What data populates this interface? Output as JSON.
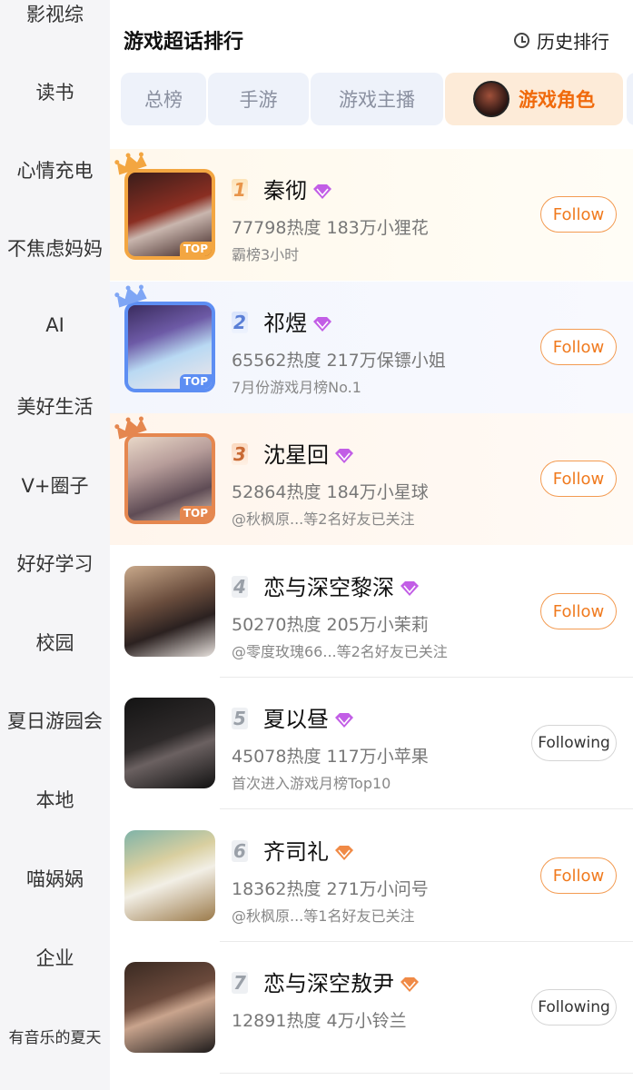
{
  "sidebar": {
    "items": [
      "影视综",
      "读书",
      "心情充电",
      "不焦虑妈妈",
      "AI",
      "美好生活",
      "V+圈子",
      "好好学习",
      "校园",
      "夏日游园会",
      "本地",
      "喵娲娲",
      "企业",
      "有音乐的夏天"
    ]
  },
  "header": {
    "title": "游戏超话排行",
    "history_label": "历史排行",
    "history_icon": "clock-icon"
  },
  "tabs": [
    {
      "label": "总榜",
      "active": false
    },
    {
      "label": "手游",
      "active": false
    },
    {
      "label": "游戏主播",
      "active": false
    },
    {
      "label": "游戏角色",
      "active": true
    }
  ],
  "colors": {
    "accent": "#f06a0c",
    "follow_border": "#f39b52",
    "sidebar_bg": "#f5f5f7"
  },
  "ranking": [
    {
      "rank": "1",
      "name": "秦彻",
      "stats": "77798热度 183万小狸花",
      "note": "霸榜3小时",
      "badge": "TOP",
      "button": "Follow"
    },
    {
      "rank": "2",
      "name": "祁煜",
      "stats": "65562热度 217万保镖小姐",
      "note": "7月份游戏月榜No.1",
      "badge": "TOP",
      "button": "Follow"
    },
    {
      "rank": "3",
      "name": "沈星回",
      "stats": "52864热度 184万小星球",
      "note": "@秋枫原...等2名好友已关注",
      "badge": "TOP",
      "button": "Follow"
    },
    {
      "rank": "4",
      "name": "恋与深空黎深",
      "stats": "50270热度 205万小茉莉",
      "note": "@零度玫瑰66...等2名好友已关注",
      "button": "Follow"
    },
    {
      "rank": "5",
      "name": "夏以昼",
      "stats": "45078热度 117万小苹果",
      "note": "首次进入游戏月榜Top10",
      "button": "Following"
    },
    {
      "rank": "6",
      "name": "齐司礼",
      "stats": "18362热度 271万小问号",
      "note": "@秋枫原...等1名好友已关注",
      "button": "Follow"
    },
    {
      "rank": "7",
      "name": "恋与深空敖尹",
      "stats": "12891热度 4万小铃兰",
      "note": "",
      "button": "Following"
    }
  ]
}
